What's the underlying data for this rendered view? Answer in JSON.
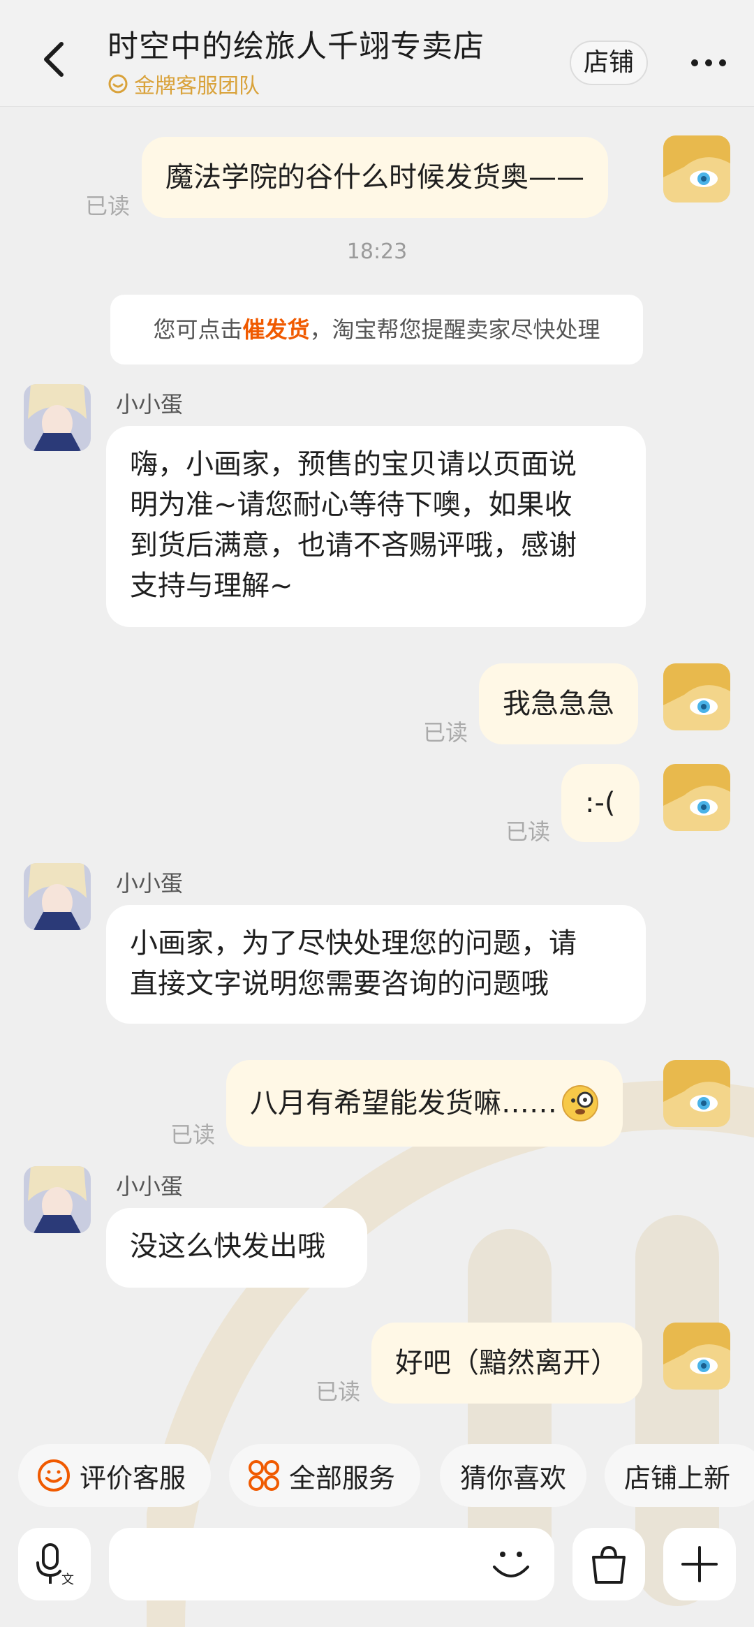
{
  "header": {
    "title": "时空中的绘旅人千翊专卖店",
    "subtitle": "金牌客服团队",
    "shop_button": "店铺"
  },
  "messages": {
    "m1": {
      "text": "魔法学院的谷什么时候发货奥——",
      "status": "已读"
    },
    "time": "18:23",
    "notice": {
      "prefix": "您可点击",
      "highlight": "催发货",
      "suffix": "，淘宝帮您提醒卖家尽快处理"
    },
    "s1": {
      "name": "小小蛋",
      "lines": [
        "嗨，小画家，预售的宝贝请以页面说",
        "明为准~请您耐心等待下噢，如果收",
        "到货后满意，也请不吝赐评哦，感谢",
        "支持与理解~"
      ]
    },
    "m2": {
      "text": "我急急急",
      "status": "已读"
    },
    "m3": {
      "text": ":-(",
      "status": "已读"
    },
    "s2": {
      "name": "小小蛋",
      "lines": [
        "小画家，为了尽快处理您的问题，请",
        "直接文字说明您需要咨询的问题哦"
      ]
    },
    "m4": {
      "text": "八月有希望能发货嘛……",
      "status": "已读"
    },
    "s3": {
      "name": "小小蛋",
      "lines": [
        "没这么快发出哦"
      ]
    },
    "m5": {
      "text": "好吧（黯然离开）",
      "status": "已读"
    }
  },
  "quick_actions": [
    "评价客服",
    "全部服务",
    "猜你喜欢",
    "店铺上新"
  ],
  "colors": {
    "accent": "#f05a00",
    "gold": "#d9a23a",
    "my_bubble": "#fff8e6"
  }
}
